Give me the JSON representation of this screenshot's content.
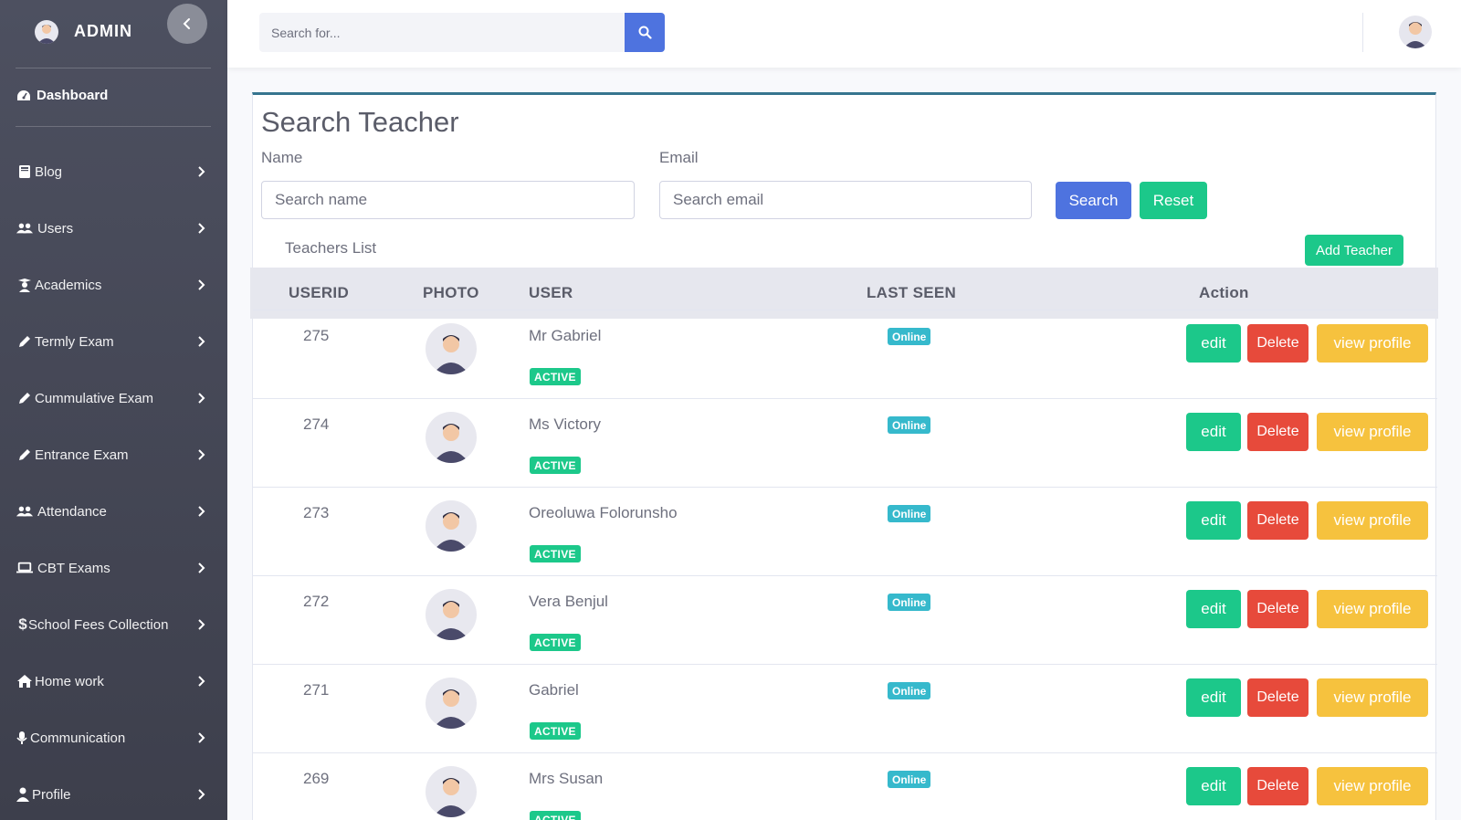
{
  "sidebar": {
    "brand": "ADMIN",
    "dashboard": "Dashboard",
    "items": [
      {
        "label": "Blog",
        "icon": "book-icon"
      },
      {
        "label": "Users",
        "icon": "users-icon"
      },
      {
        "label": "Academics",
        "icon": "graduation-icon"
      },
      {
        "label": "Termly Exam",
        "icon": "pencil-icon"
      },
      {
        "label": "Cummulative Exam",
        "icon": "pencil-icon"
      },
      {
        "label": "Entrance Exam",
        "icon": "pencil-icon"
      },
      {
        "label": "Attendance",
        "icon": "users-icon"
      },
      {
        "label": "CBT Exams",
        "icon": "laptop-icon"
      },
      {
        "label": "School Fees Collection",
        "icon": "dollar-icon"
      },
      {
        "label": "Home work",
        "icon": "home-icon"
      },
      {
        "label": "Communication",
        "icon": "microphone-icon"
      },
      {
        "label": "Profile",
        "icon": "user-icon"
      }
    ]
  },
  "topbar": {
    "search_placeholder": "Search for..."
  },
  "card": {
    "title": "Search Teacher",
    "name_label": "Name",
    "name_placeholder": "Search name",
    "email_label": "Email",
    "email_placeholder": "Search email",
    "search_button": "Search",
    "reset_button": "Reset",
    "list_label": "Teachers List",
    "add_button": "Add Teacher"
  },
  "table": {
    "headers": {
      "userid": "USERID",
      "photo": "PHOTO",
      "user": "USER",
      "last_seen": "LAST SEEN",
      "action": "Action"
    },
    "rows": [
      {
        "id": "275",
        "name": "Mr Gabriel",
        "status": "ACTIVE",
        "last_seen": "Online"
      },
      {
        "id": "274",
        "name": "Ms Victory",
        "status": "ACTIVE",
        "last_seen": "Online"
      },
      {
        "id": "273",
        "name": "Oreoluwa Folorunsho",
        "status": "ACTIVE",
        "last_seen": "Online"
      },
      {
        "id": "272",
        "name": "Vera Benjul",
        "status": "ACTIVE",
        "last_seen": "Online"
      },
      {
        "id": "271",
        "name": "Gabriel",
        "status": "ACTIVE",
        "last_seen": "Online"
      },
      {
        "id": "269",
        "name": "Mrs Susan",
        "status": "ACTIVE",
        "last_seen": "Online"
      }
    ],
    "edit_label": "edit",
    "delete_label": "Delete",
    "view_label": "view profile"
  },
  "colors": {
    "primary": "#4e73df",
    "success": "#1cc88a",
    "danger": "#e74a3b",
    "warning": "#f6c23e",
    "info": "#36b9cc",
    "sidebar": "#4d5060"
  }
}
